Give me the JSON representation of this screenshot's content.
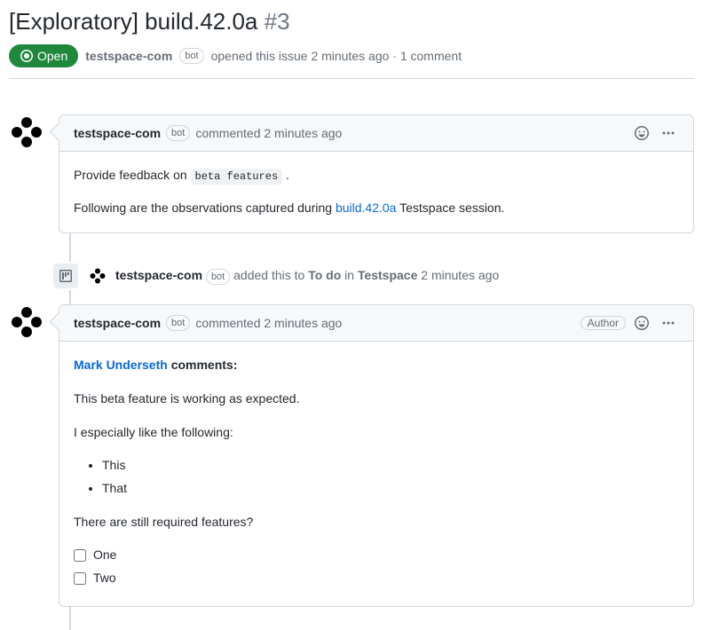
{
  "header": {
    "title": "[Exploratory] build.42.0a",
    "issue_number": "#3",
    "status": "Open",
    "author": "testspace-com",
    "bot_label": "bot",
    "opened_text": "opened this issue 2 minutes ago · 1 comment"
  },
  "comments": [
    {
      "author": "testspace-com",
      "bot_label": "bot",
      "action": "commented 2 minutes ago",
      "body": {
        "line1_prefix": "Provide feedback on ",
        "line1_code": "beta features",
        "line1_suffix": " .",
        "line2_prefix": "Following are the observations captured during ",
        "line2_link": "build.42.0a",
        "line2_suffix": " Testspace session."
      }
    },
    {
      "author": "testspace-com",
      "bot_label": "bot",
      "action": "commented 2 minutes ago",
      "author_badge": "Author",
      "body2": {
        "commenter": "Mark Underseth",
        "commenter_suffix": " comments:",
        "p1": "This beta feature is working as expected.",
        "p2": "I especially like the following:",
        "bullets": [
          "This",
          "That"
        ],
        "p3": "There are still required features?",
        "tasks": [
          "One",
          "Two"
        ]
      }
    }
  ],
  "event": {
    "author": "testspace-com",
    "bot_label": "bot",
    "prefix": " added this to ",
    "target1": "To do",
    "mid": " in ",
    "target2": "Testspace",
    "time": " 2 minutes ago"
  }
}
